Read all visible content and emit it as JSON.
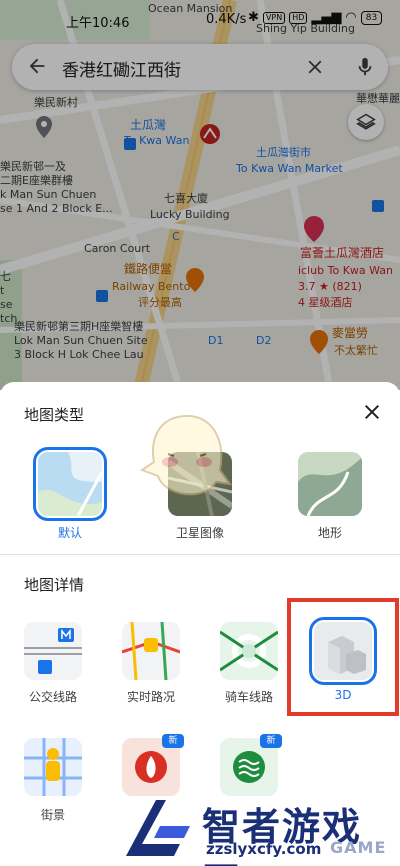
{
  "status_bar": {
    "time": "上午10:46",
    "network": "0.4K/s",
    "vpn": "VPN",
    "hd": "HD",
    "battery": "83"
  },
  "search": {
    "query": "香港红磡江西街"
  },
  "map_labels": {
    "ocean_mansion": "Ocean Mansion",
    "shing_yip": "Shing Yip Building",
    "lok_man_sun_chuen": "樂民新村",
    "tokwawan_cn": "土瓜灣",
    "tokwawan_en": "To Kwa Wan",
    "market_cn": "土瓜灣街市",
    "market_en": "To Kwa Wan Market",
    "huamao": "華懋華麗\n酒店",
    "block_e": "樂民新邨一及\n二期E座樂群樓\nk Man Sun Chuen\nse 1 And 2 Block E...",
    "lucky_cn": "七喜大廈",
    "lucky_en": "Lucky Building",
    "caron": "Caron Court",
    "railway_cn": "鐵路便當",
    "railway_en": "Railway Bento",
    "railway_note": "评分最高",
    "iclub_cn": "富薈土瓜灣酒店",
    "iclub_en": "iclub To Kwa Wan",
    "iclub_rating": "3.7 ★ (821)",
    "iclub_star": "4 星级酒店",
    "block_h": "樂民新邨第三期H座樂智樓\nLok Man Sun Chuen Site\n3 Block H Lok Chee Lau",
    "mcd": "麥當勞",
    "mcd_note": "不太繁忙",
    "d1": "D1",
    "d2": "D2",
    "c_exit": "C",
    "left_edge": "七\nt\nse\ntch"
  },
  "sheet": {
    "map_type_title": "地图类型",
    "map_types": [
      {
        "label": "默认",
        "selected": true
      },
      {
        "label": "卫星图像",
        "selected": false
      },
      {
        "label": "地形",
        "selected": false
      }
    ],
    "details_title": "地图详情",
    "details": [
      {
        "label": "公交线路",
        "new": false,
        "selected": false
      },
      {
        "label": "实时路况",
        "new": false,
        "selected": false
      },
      {
        "label": "骑车线路",
        "new": false,
        "selected": false
      },
      {
        "label": "3D",
        "new": false,
        "selected": true
      },
      {
        "label": "街景",
        "new": false,
        "selected": false
      },
      {
        "label": "野火",
        "new": true,
        "selected": false
      },
      {
        "label": "空气质量",
        "new": true,
        "selected": false
      }
    ],
    "new_badge": "新"
  },
  "watermark": {
    "name": "智者游戏网",
    "url": "zzslyxcfy.com",
    "suffix": "GAME"
  },
  "colors": {
    "accent": "#1a73e8",
    "highlight": "#e23b2a"
  }
}
